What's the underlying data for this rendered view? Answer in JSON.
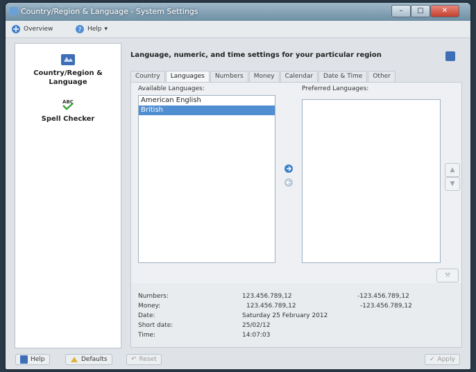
{
  "window": {
    "title": "Country/Region & Language - System Settings"
  },
  "toolbar": {
    "overview": "Overview",
    "help": "Help"
  },
  "sidebar": {
    "items": [
      {
        "label": "Country/Region & Language"
      },
      {
        "label": "Spell Checker"
      }
    ]
  },
  "main": {
    "heading": "Language, numeric, and time settings for your particular region",
    "tabs": [
      {
        "label": "Country"
      },
      {
        "label": "Languages"
      },
      {
        "label": "Numbers"
      },
      {
        "label": "Money"
      },
      {
        "label": "Calendar"
      },
      {
        "label": "Date & Time"
      },
      {
        "label": "Other"
      }
    ],
    "available_label": "Available Languages:",
    "preferred_label": "Preferred Languages:",
    "available_items": [
      {
        "label": "American English"
      },
      {
        "label": "British"
      }
    ],
    "preferred_items": []
  },
  "info": {
    "rows": [
      {
        "label": "Numbers:",
        "value": "123.456.789,12",
        "neg": "-123.456.789,12"
      },
      {
        "label": "Money:",
        "value": "123.456.789,12",
        "neg": "-123.456.789,12"
      },
      {
        "label": "Date:",
        "value": "Saturday 25 February 2012",
        "neg": ""
      },
      {
        "label": "Short date:",
        "value": "25/02/12",
        "neg": ""
      },
      {
        "label": "Time:",
        "value": "14:07:03",
        "neg": ""
      }
    ]
  },
  "bottom": {
    "help": "Help",
    "defaults": "Defaults",
    "reset": "Reset",
    "apply": "Apply"
  },
  "colors": {
    "accent": "#4f8fd1",
    "panel": "#eef0f3"
  }
}
